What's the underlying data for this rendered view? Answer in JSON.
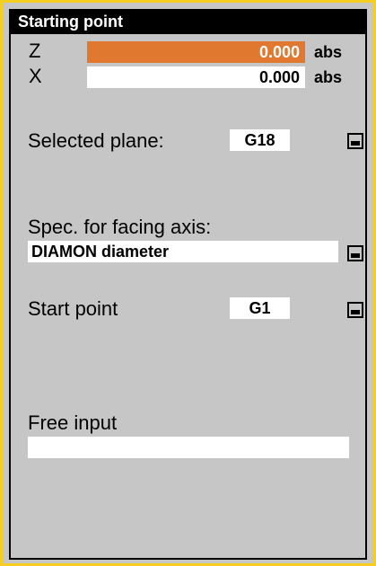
{
  "window": {
    "title": "Starting point"
  },
  "coordinates": [
    {
      "axis": "Z",
      "value": "0.000",
      "unit": "abs",
      "active": true
    },
    {
      "axis": "X",
      "value": "0.000",
      "unit": "abs",
      "active": false
    }
  ],
  "selected_plane": {
    "label": "Selected plane:",
    "value": "G18"
  },
  "facing_axis": {
    "label": "Spec. for facing axis:",
    "value": "DIAMON diameter"
  },
  "start_point": {
    "label": "Start point",
    "value": "G1"
  },
  "free_input": {
    "label": "Free input",
    "value": ""
  },
  "colors": {
    "frame_border": "#f4cf1f",
    "panel_bg": "#c6c6c6",
    "active_field": "#e0782f",
    "title_bg": "#000000"
  },
  "icons": {
    "toggle": "toggle-select-icon"
  }
}
